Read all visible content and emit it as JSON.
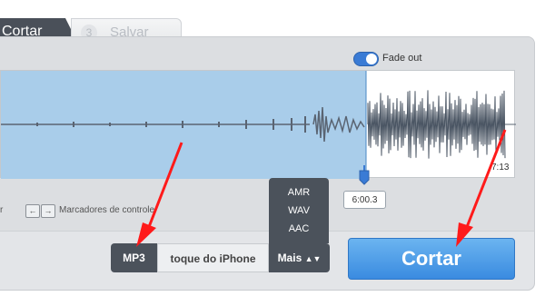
{
  "steps": {
    "active_label": "Cortar",
    "next_number": "3",
    "next_label": "Salvar"
  },
  "fade": {
    "label": "Fade out",
    "enabled": true
  },
  "waveform": {
    "end_time": "7:13",
    "current_time": "6:00.3",
    "selection_color": "#a9cdea"
  },
  "shortcuts": {
    "left_key": "←",
    "right_key": "→",
    "markers_label": "Marcadores de controle",
    "left_fragment": "r"
  },
  "formats": {
    "mp3": "MP3",
    "iphone": "toque do iPhone",
    "more": "Mais",
    "more_options": [
      "AMR",
      "WAV",
      "AAC"
    ]
  },
  "action": {
    "cut_label": "Cortar"
  },
  "colors": {
    "accent": "#3a8be0",
    "annotation": "#ff1a1a"
  }
}
